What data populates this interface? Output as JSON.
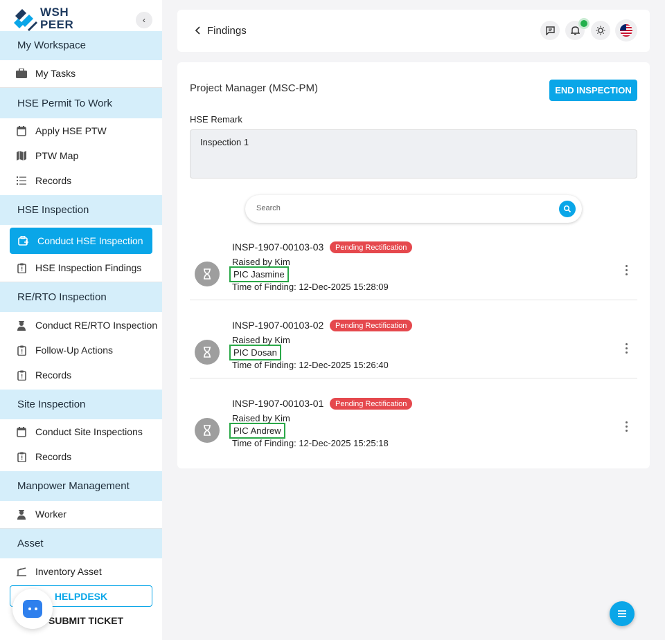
{
  "brand": {
    "line1": "WSH",
    "line2": "PEER"
  },
  "sidebar": {
    "sections": [
      {
        "label": "My Workspace"
      },
      {
        "label": "HSE Permit To Work"
      },
      {
        "label": "HSE Inspection"
      },
      {
        "label": "RE/RTO Inspection"
      },
      {
        "label": "Site Inspection"
      },
      {
        "label": "Manpower Management"
      },
      {
        "label": "Asset"
      }
    ],
    "items": [
      {
        "label": "My Tasks",
        "icon": "briefcase-icon"
      },
      {
        "label": "Apply HSE PTW",
        "icon": "calendar-icon"
      },
      {
        "label": "PTW Map",
        "icon": "map-icon"
      },
      {
        "label": "Records",
        "icon": "list-icon"
      },
      {
        "label": "Conduct HSE Inspection",
        "icon": "inspection-icon",
        "active": true
      },
      {
        "label": "HSE Inspection Findings",
        "icon": "clipboard-alert-icon"
      },
      {
        "label": "Conduct RE/RTO Inspection",
        "icon": "engineer-icon"
      },
      {
        "label": "Follow-Up Actions",
        "icon": "clipboard-alert-icon"
      },
      {
        "label": "Records",
        "icon": "clipboard-alert-icon"
      },
      {
        "label": "Conduct Site Inspections",
        "icon": "calendar-icon"
      },
      {
        "label": "Records",
        "icon": "clipboard-alert-icon"
      },
      {
        "label": "Worker",
        "icon": "worker-icon"
      },
      {
        "label": "Inventory Asset",
        "icon": "crane-icon"
      }
    ],
    "helpdesk_label": "HELPDESK",
    "submit_ticket_label": "SUBMIT TICKET"
  },
  "header": {
    "title": "Findings"
  },
  "main": {
    "title": "Project Manager (MSC-PM)",
    "end_button": "END INSPECTION",
    "remark_label": "HSE Remark",
    "remark_value": "Inspection 1",
    "search_placeholder": "Search"
  },
  "findings": [
    {
      "id": "INSP-1907-00103-03",
      "status": "Pending Rectification",
      "raised_by": "Raised by Kim",
      "pic": "PIC Jasmine",
      "time": "Time of Finding: 12-Dec-2025 15:28:09"
    },
    {
      "id": "INSP-1907-00103-02",
      "status": "Pending Rectification",
      "raised_by": "Raised by Kim",
      "pic": "PIC Dosan",
      "time": "Time of Finding: 12-Dec-2025 15:26:40"
    },
    {
      "id": "INSP-1907-00103-01",
      "status": "Pending Rectification",
      "raised_by": "Raised by Kim",
      "pic": "PIC Andrew",
      "time": "Time of Finding: 12-Dec-2025 15:25:18"
    }
  ],
  "colors": {
    "accent": "#0aa6e8",
    "section_bg": "#d5eefa",
    "badge": "#e5484d",
    "highlight": "#2aa848"
  }
}
